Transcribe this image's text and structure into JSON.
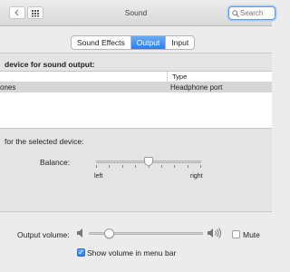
{
  "window": {
    "title": "Sound"
  },
  "search": {
    "placeholder": "Search",
    "value": ""
  },
  "tabs": [
    {
      "label": "Sound Effects"
    },
    {
      "label": "Output"
    },
    {
      "label": "Input"
    }
  ],
  "output": {
    "select_heading": "device for sound output:",
    "table": {
      "columns": [
        "",
        "Type"
      ],
      "rows": [
        {
          "name": "ones",
          "type": "Headphone port"
        }
      ]
    },
    "settings_heading": "for the selected device:",
    "balance": {
      "label": "Balance:",
      "left_label": "left",
      "right_label": "right",
      "value": 0.5
    }
  },
  "volume": {
    "label": "Output volume:",
    "level": 0.18,
    "mute_label": "Mute",
    "mute_checked": false,
    "show_in_menubar_label": "Show volume in menu bar",
    "show_in_menubar_checked": true
  },
  "colors": {
    "accent": "#2f7de9",
    "focus_ring": "#5a9ae6"
  }
}
